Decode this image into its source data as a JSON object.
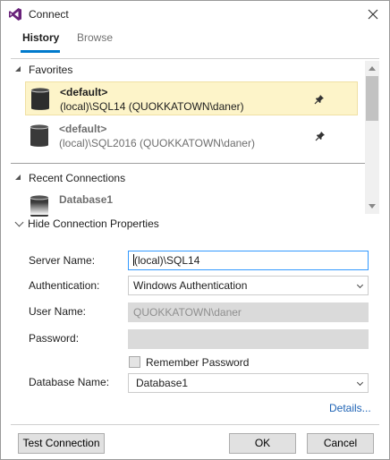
{
  "window": {
    "title": "Connect"
  },
  "tabs": [
    {
      "label": "History",
      "active": true
    },
    {
      "label": "Browse",
      "active": false
    }
  ],
  "history": {
    "favorites_label": "Favorites",
    "favorites": [
      {
        "name": "<default>",
        "detail": "(local)\\SQL14 (QUOKKATOWN\\daner)",
        "selected": true,
        "pinned": true
      },
      {
        "name": "<default>",
        "detail": "(local)\\SQL2016 (QUOKKATOWN\\daner)",
        "selected": false,
        "pinned": true
      }
    ],
    "recent_label": "Recent Connections",
    "recent": [
      {
        "name": "Database1"
      }
    ]
  },
  "properties": {
    "toggle_label": "Hide Connection Properties",
    "server_name_label": "Server Name:",
    "server_name_value": "(local)\\SQL14",
    "authentication_label": "Authentication:",
    "authentication_value": "Windows Authentication",
    "user_name_label": "User Name:",
    "user_name_value": "QUOKKATOWN\\daner",
    "password_label": "Password:",
    "password_value": "",
    "remember_password_label": "Remember Password",
    "remember_password_checked": false,
    "database_name_label": "Database Name:",
    "database_name_value": "Database1",
    "details_link": "Details..."
  },
  "buttons": {
    "test_connection": "Test Connection",
    "ok": "OK",
    "cancel": "Cancel"
  },
  "colors": {
    "accent": "#007acc",
    "selected_bg": "#fdf4c9",
    "link": "#1e63b5",
    "vs_purple": "#68217a"
  }
}
